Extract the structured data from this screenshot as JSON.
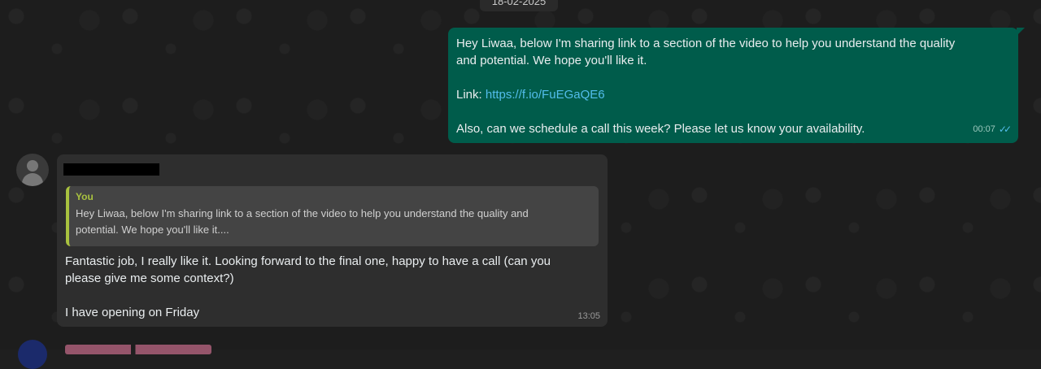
{
  "date_separator": "18-02-2025",
  "outgoing": {
    "line1": "Hey Liwaa, below I'm sharing link to a section of the video to help you understand the quality",
    "line2": "and potential. We hope you'll like it.",
    "link_label": "Link: ",
    "link_url": "https://f.io/FuEGaQE6",
    "line3": "Also, can we schedule a call this week? Please let us know your availability.",
    "time": "00:07",
    "status": "read"
  },
  "incoming": {
    "quote": {
      "author": "You",
      "text": "Hey Liwaa, below I'm sharing link to a section of the video to help you understand the quality and potential. We hope you'll like it...."
    },
    "line1": "Fantastic job, I really like it. Looking forward to the final one, happy to have a call (can you",
    "line2": "please give me some context?)",
    "line3": "I have opening on Friday",
    "time": "13:05"
  },
  "colors": {
    "outgoing_bubble": "#005c4b",
    "incoming_bubble": "#2e2e2e",
    "quote_accent": "#a9c23f",
    "link": "#53bdeb"
  }
}
